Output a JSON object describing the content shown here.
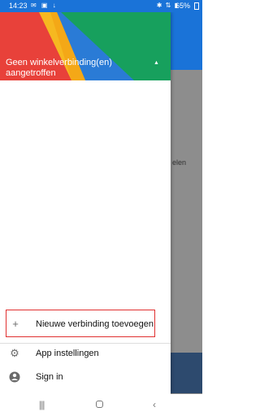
{
  "status_bar": {
    "time": "14:23",
    "battery": "65%"
  },
  "drawer": {
    "header_title": "Geen winkelverbinding(en) aangetroffen",
    "items": [
      {
        "label": "Nieuwe verbinding toevoegen",
        "icon": "plus-icon"
      },
      {
        "label": "App instellingen",
        "icon": "gear-icon"
      },
      {
        "label": "Sign in",
        "icon": "account-icon"
      }
    ]
  },
  "background": {
    "partial_text": "elen"
  },
  "colors": {
    "header_blue": "#1a73d8",
    "red": "#e8413a",
    "yellow": "#f6b820",
    "green": "#17a05d",
    "blue": "#2a7bd6"
  }
}
